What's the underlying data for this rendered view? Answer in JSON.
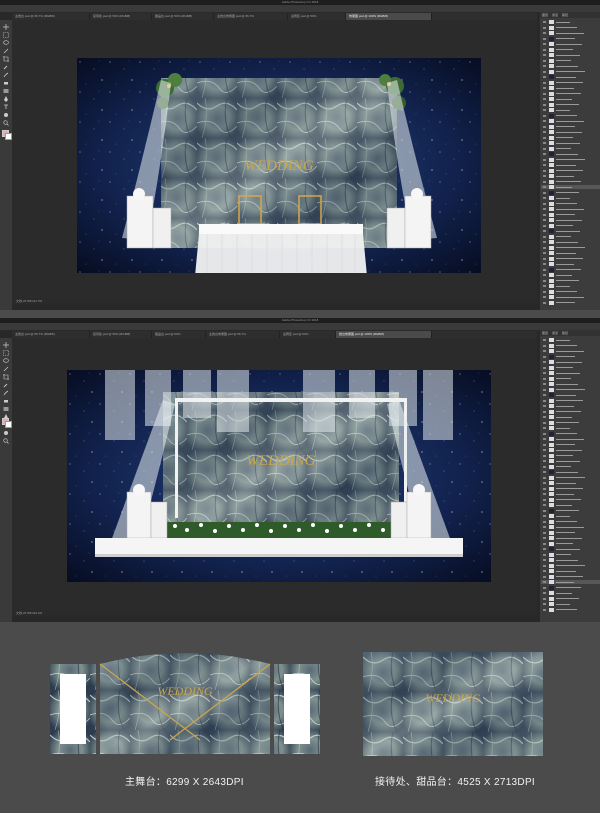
{
  "top_window": {
    "app_title": "Adobe Photoshop CC 2018",
    "tabs": [
      {
        "label": "主舞台.psd @ 66.7% (RGB/8)",
        "active": false
      },
      {
        "label": "接待处.psd @ 50% (RGB/8)",
        "active": false
      },
      {
        "label": "甜品台.psd @ 50% (RGB/8)",
        "active": false
      },
      {
        "label": "主舞台效果图.psd @ 66.7%",
        "active": false
      },
      {
        "label": "迎宾区.psd @ 50%",
        "active": false
      },
      {
        "label": "效果图.psd @ 100% (RGB/8)",
        "active": true
      }
    ],
    "status_text": "文档:26.5M/312.7M",
    "wedding_text": "WEDDING"
  },
  "bottom_window": {
    "app_title": "Adobe Photoshop CC 2018",
    "tabs": [
      {
        "label": "主舞台.psd @ 66.7% (RGB/8)",
        "active": false
      },
      {
        "label": "接待处.psd @ 50% (RGB/8)",
        "active": false
      },
      {
        "label": "甜品台.psd @ 50%",
        "active": false
      },
      {
        "label": "主舞台效果图.psd @ 66.7%",
        "active": false
      },
      {
        "label": "迎宾区.psd @ 50%",
        "active": false
      },
      {
        "label": "舞台效果图.psd @ 100% (RGB/8)",
        "active": true
      }
    ],
    "status_text": "文档:26.5M/349.1M",
    "wedding_text": "WEDDING"
  },
  "panel_tabs": [
    "图层",
    "通道",
    "路径"
  ],
  "previews": {
    "main_stage_wedding": "WEDDING",
    "reception_wedding": "WEDDING"
  },
  "captions": {
    "main_stage": "主舞台：6299 X 2643DPI",
    "reception": "接待处、甜品台：4525 X 2713DPI"
  },
  "colors": {
    "ps_dark": "#282828",
    "ps_panel": "#3c3c3c",
    "outer_bg": "#4b4b4b",
    "gold": "#c9a64a",
    "night_sky": "#0d1b3d"
  },
  "icons": [
    "move-icon",
    "marquee-icon",
    "lasso-icon",
    "magic-wand-icon",
    "crop-icon",
    "eyedropper-icon",
    "brush-icon",
    "eraser-icon",
    "gradient-icon",
    "pen-icon",
    "type-icon",
    "hand-icon",
    "zoom-icon"
  ]
}
